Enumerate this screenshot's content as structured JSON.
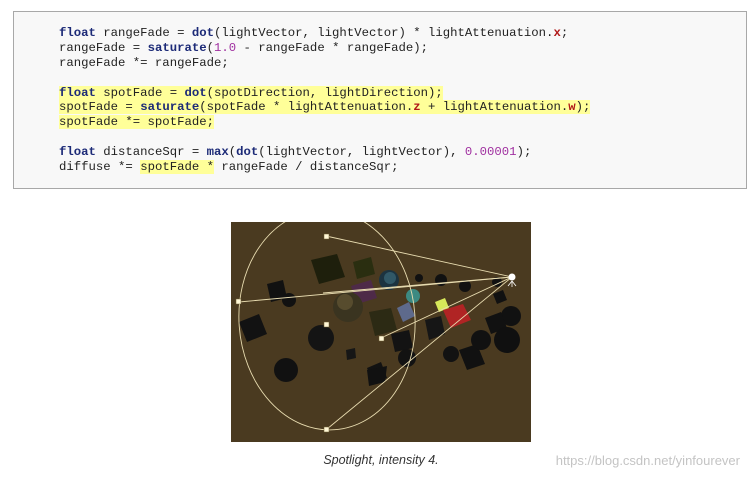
{
  "code": {
    "lines": [
      [
        {
          "t": "float",
          "c": "kw"
        },
        {
          "t": " rangeFade = "
        },
        {
          "t": "dot",
          "c": "fn"
        },
        {
          "t": "(lightVector, lightVector) * lightAttenuation."
        },
        {
          "t": "x",
          "c": "comp"
        },
        {
          "t": ";"
        }
      ],
      [
        {
          "t": "rangeFade = "
        },
        {
          "t": "saturate",
          "c": "fn"
        },
        {
          "t": "("
        },
        {
          "t": "1.0",
          "c": "num"
        },
        {
          "t": " - rangeFade * rangeFade);"
        }
      ],
      [
        {
          "t": "rangeFade *= rangeFade;"
        }
      ],
      [],
      [
        {
          "t": "float",
          "c": "kw",
          "h": true
        },
        {
          "t": " spotFade = ",
          "h": true
        },
        {
          "t": "dot",
          "c": "fn",
          "h": true
        },
        {
          "t": "(spotDirection, lightDirection);",
          "h": true
        }
      ],
      [
        {
          "t": "spotFade = ",
          "h": true
        },
        {
          "t": "saturate",
          "c": "fn",
          "h": true
        },
        {
          "t": "(spotFade * lightAttenuation.",
          "h": true
        },
        {
          "t": "z",
          "c": "comp",
          "h": true
        },
        {
          "t": " + lightAttenuation.",
          "h": true
        },
        {
          "t": "w",
          "c": "comp",
          "h": true
        },
        {
          "t": ");",
          "h": true
        }
      ],
      [
        {
          "t": "spotFade *= spotFade;",
          "h": true
        }
      ],
      [],
      [
        {
          "t": "float",
          "c": "kw"
        },
        {
          "t": " distanceSqr = "
        },
        {
          "t": "max",
          "c": "fn"
        },
        {
          "t": "("
        },
        {
          "t": "dot",
          "c": "fn"
        },
        {
          "t": "(lightVector, lightVector), "
        },
        {
          "t": "0.00001",
          "c": "num"
        },
        {
          "t": ");"
        }
      ],
      [
        {
          "t": "diffuse *= "
        },
        {
          "t": "spotFade *",
          "h": true
        },
        {
          "t": " rangeFade / distanceSqr;"
        }
      ]
    ]
  },
  "figure": {
    "alt": "Spotlight scene with cone gizmo",
    "background": "#4a3a20"
  },
  "caption": "Spotlight, intensity 4.",
  "watermark": "https://blog.csdn.net/yinfourever"
}
